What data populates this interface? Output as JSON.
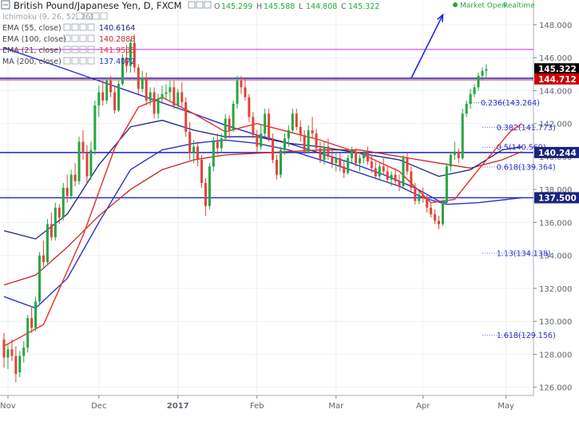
{
  "header": {
    "title": "British Pound/Japanese Yen, D, FXCM",
    "ohlc_labels": [
      "O",
      "H",
      "L",
      "C"
    ],
    "ohlc_values": [
      "145.299",
      "145.588",
      "144.808",
      "145.322"
    ],
    "status": "Market Open",
    "mode": "Realtime"
  },
  "indicators": [
    {
      "label": "Ichimoku (9, 26, 52, 26)",
      "value": "",
      "color": "#9aa4ad"
    },
    {
      "label": "EMA (55, close)",
      "value": "140.6164",
      "color": "#1a237e"
    },
    {
      "label": "EMA (100, close)",
      "value": "140.2888",
      "color": "#c62828"
    },
    {
      "label": "EMA (21, close)",
      "value": "141.9505",
      "color": "#e53935"
    },
    {
      "label": "MA (200, close)",
      "value": "137.4072",
      "color": "#1a34c8"
    }
  ],
  "price_tags": [
    {
      "value": "145.322",
      "color": "#000000"
    },
    {
      "value": "144.712",
      "color": "#cc0000"
    },
    {
      "value": "140.244",
      "color": "#1a237e"
    },
    {
      "value": "137.500",
      "color": "#1a237e"
    }
  ],
  "chart_data": {
    "type": "candlestick",
    "ylim": [
      125.5,
      149.5
    ],
    "y_ticks": [
      126,
      128,
      130,
      132,
      134,
      136,
      138,
      140,
      142,
      144,
      146,
      148
    ],
    "x_ticks": [
      "Nov",
      "Dec",
      "2017",
      "Feb",
      "Mar",
      "Apr",
      "May"
    ],
    "x_tick_idx": [
      1,
      24,
      44,
      64,
      84,
      106,
      127
    ],
    "n": 132,
    "colors": {
      "up": "#26a641",
      "down": "#e0443a",
      "h_line": "#2d2fc9",
      "fib_line": "#bf35c9",
      "trend": "#1f2ad6"
    },
    "horizontal_lines": [
      144.75,
      140.244,
      137.5
    ],
    "upper_line": 146.5,
    "fib_levels": [
      {
        "label": "0.236(143.264)",
        "value": 143.264,
        "start": 121
      },
      {
        "label": "0.382(141.773)",
        "value": 141.773,
        "start": 125
      },
      {
        "label": "0.5(140.569)",
        "value": 140.569,
        "start": 125
      },
      {
        "label": "0.618(139.364)",
        "value": 139.364,
        "start": 125
      },
      {
        "label": "1.13(134.138)",
        "value": 134.138,
        "start": 125
      },
      {
        "label": "1.618(129.156)",
        "value": 129.156,
        "start": 125
      }
    ],
    "trend_arrow": [
      [
        103,
        144.75
      ],
      [
        111,
        148.6
      ]
    ],
    "candles": [
      [
        128.9,
        129.3,
        127.2,
        127.8
      ],
      [
        127.8,
        128.6,
        127.1,
        128.3
      ],
      [
        128.3,
        128.9,
        127.6,
        127.9
      ],
      [
        127.9,
        128.5,
        126.3,
        126.8
      ],
      [
        126.9,
        128.2,
        126.6,
        127.9
      ],
      [
        127.9,
        128.8,
        127.5,
        128.4
      ],
      [
        128.4,
        130.4,
        128.1,
        130.2
      ],
      [
        130.2,
        130.9,
        129.3,
        129.6
      ],
      [
        129.6,
        131.5,
        129.4,
        131.2
      ],
      [
        131.2,
        134.2,
        131,
        134
      ],
      [
        134,
        134.9,
        133.3,
        133.6
      ],
      [
        133.6,
        136.2,
        133.4,
        135.9
      ],
      [
        135.9,
        136.6,
        134.9,
        135.1
      ],
      [
        135.1,
        137.2,
        134.9,
        136.9
      ],
      [
        136.9,
        137.1,
        135.9,
        136.3
      ],
      [
        136.3,
        138.4,
        136.1,
        138.1
      ],
      [
        138.1,
        138.9,
        137.2,
        137.6
      ],
      [
        137.6,
        139.2,
        137.4,
        138.9
      ],
      [
        138.9,
        139.6,
        138.2,
        138.5
      ],
      [
        138.5,
        141.2,
        138.3,
        140.9
      ],
      [
        140.9,
        141.6,
        139.8,
        140.2
      ],
      [
        140.2,
        140.7,
        138.4,
        138.8
      ],
      [
        138.8,
        140.9,
        138.6,
        140.4
      ],
      [
        140.4,
        143.4,
        140.1,
        143.1
      ],
      [
        143.1,
        144.3,
        142.4,
        143.9
      ],
      [
        143.9,
        144.6,
        143.1,
        143.4
      ],
      [
        143.4,
        144.8,
        143.2,
        144.6
      ],
      [
        144.6,
        144.9,
        143.6,
        143.9
      ],
      [
        143.9,
        144.3,
        142.6,
        142.8
      ],
      [
        142.8,
        144.6,
        142.7,
        144.4
      ],
      [
        144.4,
        146.2,
        144.3,
        146
      ],
      [
        146,
        146.8,
        145.1,
        145.5
      ],
      [
        145.5,
        147.1,
        145.1,
        146.9
      ],
      [
        146.9,
        147.4,
        145.1,
        145.4
      ],
      [
        145.4,
        145.6,
        143.8,
        144.1
      ],
      [
        144.1,
        145.2,
        143.9,
        144.8
      ],
      [
        144.8,
        145.1,
        143.1,
        143.4
      ],
      [
        143.4,
        144.2,
        143.1,
        143.9
      ],
      [
        143.9,
        144.2,
        142.3,
        142.6
      ],
      [
        142.6,
        143.8,
        142.3,
        143.5
      ],
      [
        143.5,
        144.3,
        143.2,
        143.8
      ],
      [
        143.8,
        144.4,
        143.5,
        143.9
      ],
      [
        143.9,
        144.6,
        143.4,
        144.2
      ],
      [
        144.2,
        144.6,
        142.9,
        143.1
      ],
      [
        143.1,
        144.1,
        142.9,
        143.9
      ],
      [
        143.9,
        144.5,
        143,
        143.3
      ],
      [
        143.3,
        143.6,
        141.2,
        141.5
      ],
      [
        141.5,
        142.1,
        139.8,
        140.2
      ],
      [
        140.2,
        141,
        139.6,
        140.6
      ],
      [
        140.6,
        140.9,
        139.4,
        139.8
      ],
      [
        139.8,
        140.1,
        138.1,
        138.4
      ],
      [
        138.4,
        138.7,
        136.4,
        137
      ],
      [
        137,
        139.6,
        136.8,
        139.4
      ],
      [
        139.4,
        141.2,
        139.1,
        140.9
      ],
      [
        140.9,
        141.4,
        140.1,
        140.5
      ],
      [
        140.5,
        141.4,
        140.2,
        141.1
      ],
      [
        141.1,
        142.6,
        140.9,
        142.3
      ],
      [
        142.3,
        142.5,
        141.1,
        141.6
      ],
      [
        141.6,
        143.4,
        141.5,
        143.2
      ],
      [
        143.2,
        144.9,
        142.9,
        144.6
      ],
      [
        144.6,
        144.9,
        143.8,
        144.2
      ],
      [
        144.2,
        144.8,
        143.4,
        143.6
      ],
      [
        143.6,
        143.8,
        142.1,
        142.4
      ],
      [
        142.4,
        142.7,
        141.1,
        141.3
      ],
      [
        141.3,
        141.6,
        140.3,
        140.6
      ],
      [
        140.6,
        141.9,
        140.4,
        141.4
      ],
      [
        141.4,
        142.9,
        141.2,
        142.6
      ],
      [
        142.6,
        142.9,
        140.9,
        141.1
      ],
      [
        141.1,
        141.4,
        139.6,
        139.8
      ],
      [
        139.8,
        140.1,
        138.6,
        138.9
      ],
      [
        138.9,
        140.6,
        138.7,
        140.4
      ],
      [
        140.4,
        141.4,
        140.1,
        141.1
      ],
      [
        141.1,
        141.9,
        140.6,
        141.6
      ],
      [
        141.6,
        142.9,
        141.4,
        142.6
      ],
      [
        142.6,
        142.9,
        141.6,
        141.8
      ],
      [
        141.8,
        142.2,
        140.9,
        141.3
      ],
      [
        141.3,
        141.6,
        140.1,
        140.3
      ],
      [
        140.3,
        141.9,
        140.2,
        141.6
      ],
      [
        141.6,
        142.4,
        141.1,
        141.4
      ],
      [
        141.4,
        141.7,
        140.3,
        140.5
      ],
      [
        140.5,
        140.9,
        139.6,
        139.8
      ],
      [
        139.8,
        140.9,
        139.5,
        140.6
      ],
      [
        140.6,
        141.1,
        139.8,
        140
      ],
      [
        140,
        140.4,
        139.3,
        139.6
      ],
      [
        139.6,
        140.3,
        139.1,
        139.9
      ],
      [
        139.9,
        140.2,
        139.1,
        139.4
      ],
      [
        139.4,
        139.7,
        138.7,
        139
      ],
      [
        139,
        140.1,
        138.9,
        139.9
      ],
      [
        139.9,
        140.6,
        139.6,
        140.3
      ],
      [
        140.3,
        140.5,
        139.4,
        139.6
      ],
      [
        139.6,
        140.1,
        139.1,
        139.9
      ],
      [
        139.9,
        140.4,
        139.6,
        140.2
      ],
      [
        140.2,
        140.6,
        139.5,
        139.7
      ],
      [
        139.7,
        140.1,
        139,
        139.3
      ],
      [
        139.3,
        139.7,
        138.6,
        138.8
      ],
      [
        138.8,
        139.6,
        138.6,
        139.4
      ],
      [
        139.4,
        139.9,
        138.9,
        139.1
      ],
      [
        139.1,
        139.4,
        138.4,
        138.6
      ],
      [
        138.6,
        139.1,
        138.2,
        138.9
      ],
      [
        138.9,
        139.3,
        138.3,
        138.5
      ],
      [
        138.5,
        138.9,
        137.9,
        138.2
      ],
      [
        138.2,
        140.1,
        138.1,
        139.9
      ],
      [
        139.9,
        140.2,
        138.9,
        139.1
      ],
      [
        139.1,
        139.4,
        137.9,
        138.1
      ],
      [
        138.1,
        138.4,
        137.1,
        137.3
      ],
      [
        137.3,
        137.9,
        137.1,
        137.7
      ],
      [
        137.7,
        138.1,
        137.2,
        137.5
      ],
      [
        137.5,
        137.7,
        136.6,
        136.9
      ],
      [
        136.9,
        137.2,
        136.3,
        136.5
      ],
      [
        136.5,
        136.8,
        135.9,
        136.1
      ],
      [
        136.1,
        136.4,
        135.6,
        135.9
      ],
      [
        135.9,
        137.4,
        135.8,
        137.2
      ],
      [
        137.2,
        139.6,
        137.1,
        139.4
      ],
      [
        139.4,
        140.3,
        139.1,
        140.1
      ],
      [
        140.1,
        140.9,
        139.8,
        140.3
      ],
      [
        140.3,
        140.5,
        139.6,
        139.9
      ],
      [
        139.9,
        142.9,
        139.8,
        142.6
      ],
      [
        142.6,
        143.4,
        142.4,
        143.2
      ],
      [
        143.2,
        144.1,
        142.9,
        143.8
      ],
      [
        143.8,
        144.4,
        143.6,
        144.2
      ],
      [
        144.2,
        145.1,
        144,
        144.9
      ],
      [
        144.9,
        145.4,
        144.6,
        145.2
      ],
      [
        145.2,
        145.6,
        144.8,
        145.3
      ]
    ],
    "ema21": [
      [
        0,
        128.5
      ],
      [
        10,
        129.8
      ],
      [
        20,
        135.2
      ],
      [
        28,
        140.5
      ],
      [
        34,
        143
      ],
      [
        40,
        143.6
      ],
      [
        48,
        142.6
      ],
      [
        56,
        141.5
      ],
      [
        64,
        142
      ],
      [
        72,
        141.5
      ],
      [
        80,
        141
      ],
      [
        90,
        140.2
      ],
      [
        100,
        139.1
      ],
      [
        108,
        137.2
      ],
      [
        114,
        137.4
      ],
      [
        120,
        139.2
      ],
      [
        128,
        141.5
      ],
      [
        131,
        142
      ]
    ],
    "ema55": [
      [
        0,
        135.5
      ],
      [
        8,
        135
      ],
      [
        16,
        136.5
      ],
      [
        24,
        139.5
      ],
      [
        32,
        141.8
      ],
      [
        40,
        142.2
      ],
      [
        48,
        141.6
      ],
      [
        56,
        141.2
      ],
      [
        64,
        141.2
      ],
      [
        72,
        140.8
      ],
      [
        80,
        140.6
      ],
      [
        90,
        140.2
      ],
      [
        100,
        139.8
      ],
      [
        110,
        138.8
      ],
      [
        118,
        139.2
      ],
      [
        126,
        140.4
      ],
      [
        131,
        140.6
      ]
    ],
    "ema100": [
      [
        0,
        132.2
      ],
      [
        8,
        132.8
      ],
      [
        16,
        134.5
      ],
      [
        24,
        136.4
      ],
      [
        32,
        138
      ],
      [
        40,
        139.2
      ],
      [
        48,
        139.8
      ],
      [
        56,
        140.1
      ],
      [
        64,
        140.2
      ],
      [
        72,
        140.3
      ],
      [
        80,
        140.4
      ],
      [
        90,
        140.4
      ],
      [
        100,
        140
      ],
      [
        110,
        139.6
      ],
      [
        118,
        139.3
      ],
      [
        126,
        139.8
      ],
      [
        131,
        140.3
      ]
    ],
    "ma200": [
      [
        0,
        131.5
      ],
      [
        8,
        130.8
      ],
      [
        16,
        132.6
      ],
      [
        24,
        136
      ],
      [
        32,
        139.2
      ],
      [
        40,
        140.4
      ],
      [
        48,
        140.8
      ],
      [
        56,
        141
      ],
      [
        64,
        140.8
      ],
      [
        72,
        140.4
      ],
      [
        80,
        139.8
      ],
      [
        90,
        139
      ],
      [
        100,
        138.2
      ],
      [
        106,
        137.5
      ],
      [
        112,
        137.1
      ],
      [
        120,
        137.2
      ],
      [
        131,
        137.5
      ]
    ],
    "blue_trendline": [
      [
        0,
        146.6
      ],
      [
        12,
        145.6
      ],
      [
        24,
        144.6
      ],
      [
        36,
        143.6
      ],
      [
        48,
        142.6
      ],
      [
        56,
        141.9
      ],
      [
        64,
        141.3
      ],
      [
        72,
        140.8
      ],
      [
        80,
        140.2
      ],
      [
        88,
        139.6
      ],
      [
        96,
        138.9
      ],
      [
        104,
        138.1
      ],
      [
        110,
        137.3
      ],
      [
        112,
        137.2
      ]
    ]
  }
}
